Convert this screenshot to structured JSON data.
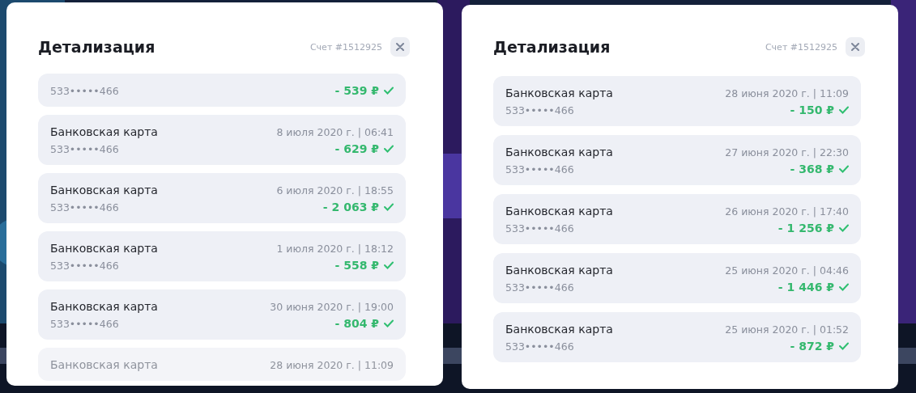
{
  "panels": [
    {
      "title": "Детализация",
      "account": "Счет #1512925",
      "items": [
        {
          "card": "533•••••466",
          "amount": "- 539 ₽",
          "confirmed": true,
          "dimmed": false
        },
        {
          "title": "Банковская карта",
          "date": "8 июля 2020 г. | 06:41",
          "card": "533•••••466",
          "amount": "- 629 ₽",
          "confirmed": true,
          "dimmed": false
        },
        {
          "title": "Банковская карта",
          "date": "6 июля 2020 г. | 18:55",
          "card": "533•••••466",
          "amount": "- 2 063 ₽",
          "confirmed": true,
          "dimmed": false
        },
        {
          "title": "Банковская карта",
          "date": "1 июля 2020 г. | 18:12",
          "card": "533•••••466",
          "amount": "- 558 ₽",
          "confirmed": true,
          "dimmed": false
        },
        {
          "title": "Банковская карта",
          "date": "30 июня 2020 г. | 19:00",
          "card": "533•••••466",
          "amount": "- 804 ₽",
          "confirmed": true,
          "dimmed": false
        },
        {
          "title": "Банковская карта",
          "date": "28 июня 2020 г. | 11:09",
          "dimmed": true
        }
      ]
    },
    {
      "title": "Детализация",
      "account": "Счет #1512925",
      "items": [
        {
          "title": "Банковская карта",
          "date": "28 июня 2020 г. | 11:09",
          "card": "533•••••466",
          "amount": "- 150 ₽",
          "confirmed": true,
          "dimmed": false
        },
        {
          "title": "Банковская карта",
          "date": "27 июня 2020 г. | 22:30",
          "card": "533•••••466",
          "amount": "- 368 ₽",
          "confirmed": true,
          "dimmed": false
        },
        {
          "title": "Банковская карта",
          "date": "26 июня 2020 г. | 17:40",
          "card": "533•••••466",
          "amount": "- 1 256 ₽",
          "confirmed": true,
          "dimmed": false
        },
        {
          "title": "Банковская карта",
          "date": "25 июня 2020 г. | 04:46",
          "card": "533•••••466",
          "amount": "- 1 446 ₽",
          "confirmed": true,
          "dimmed": false
        },
        {
          "title": "Банковская карта",
          "date": "25 июня 2020 г. | 01:52",
          "card": "533•••••466",
          "amount": "- 872 ₽",
          "confirmed": true,
          "dimmed": false
        }
      ]
    }
  ]
}
